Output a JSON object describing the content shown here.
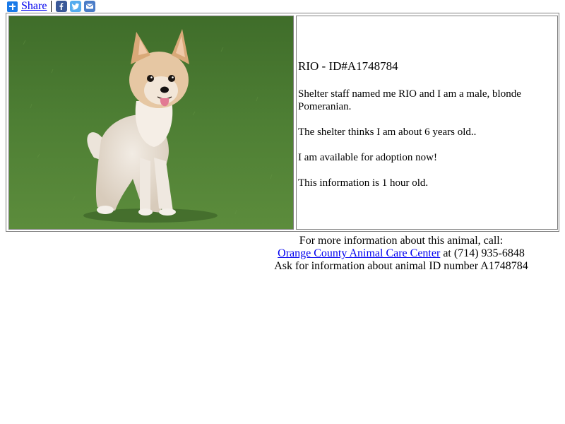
{
  "share": {
    "label": "Share",
    "icons": [
      "share-plus-icon",
      "facebook-icon",
      "twitter-icon",
      "email-icon"
    ],
    "colors": {
      "share": "#1a7ae8",
      "facebook": "#3b5998",
      "twitter": "#55acee",
      "email": "#4a7cc7"
    }
  },
  "pet": {
    "title": "RIO - ID#A1748784",
    "description": "Shelter staff named me RIO and I am a male, blonde Pomeranian.",
    "age": "The shelter thinks I am about 6 years old..",
    "availability": "I am available for adoption now!",
    "freshness": "This information is 1 hour old.",
    "photo_subject": "pomeranian-dog-photo"
  },
  "contact": {
    "line1": "For more information about this animal, call:",
    "center_link": "Orange County Animal Care Center",
    "phone_prefix": " at (714) 935-6848",
    "line3": "Ask for information about animal ID number A1748784"
  },
  "colors": {
    "link": "#0000ee",
    "grass": "#4a7a32",
    "border": "#808080"
  }
}
